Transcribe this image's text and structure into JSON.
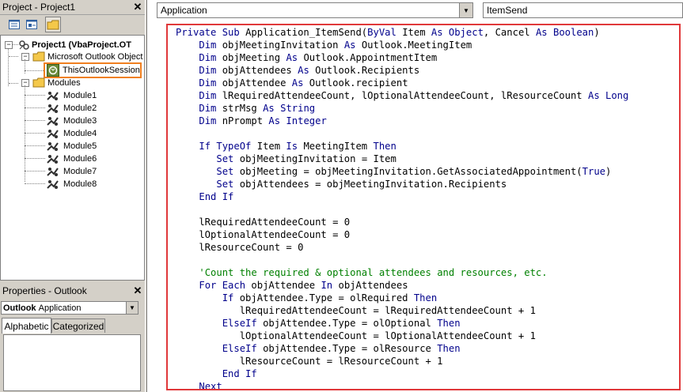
{
  "project_panel": {
    "title": "Project - Project1",
    "tree": {
      "root": "Project1 (VbaProject.OT",
      "folder_outlook": "Microsoft Outlook Object",
      "session": "ThisOutlookSession",
      "folder_modules": "Modules",
      "modules": [
        "Module1",
        "Module2",
        "Module3",
        "Module4",
        "Module5",
        "Module6",
        "Module7",
        "Module8"
      ]
    }
  },
  "properties_panel": {
    "title": "Properties - Outlook",
    "object_name": "Outlook",
    "object_type": "Application",
    "tabs": [
      "Alphabetic",
      "Categorized"
    ]
  },
  "editor": {
    "object_combo": "Application",
    "procedure_combo": "ItemSend",
    "code_lines": [
      [
        [
          "kw",
          "Private Sub "
        ],
        [
          "",
          "Application_ItemSend("
        ],
        [
          "kw",
          "ByVal "
        ],
        [
          "",
          "Item "
        ],
        [
          "kw",
          "As Object"
        ],
        [
          "",
          ", Cancel "
        ],
        [
          "kw",
          "As Boolean"
        ],
        [
          "",
          ")"
        ]
      ],
      [
        [
          "",
          "    "
        ],
        [
          "kw",
          "Dim "
        ],
        [
          "",
          "objMeetingInvitation "
        ],
        [
          "kw",
          "As "
        ],
        [
          "",
          "Outlook.MeetingItem"
        ]
      ],
      [
        [
          "",
          "    "
        ],
        [
          "kw",
          "Dim "
        ],
        [
          "",
          "objMeeting "
        ],
        [
          "kw",
          "As "
        ],
        [
          "",
          "Outlook.AppointmentItem"
        ]
      ],
      [
        [
          "",
          "    "
        ],
        [
          "kw",
          "Dim "
        ],
        [
          "",
          "objAttendees "
        ],
        [
          "kw",
          "As "
        ],
        [
          "",
          "Outlook.Recipients"
        ]
      ],
      [
        [
          "",
          "    "
        ],
        [
          "kw",
          "Dim "
        ],
        [
          "",
          "objAttendee "
        ],
        [
          "kw",
          "As "
        ],
        [
          "",
          "Outlook.recipient"
        ]
      ],
      [
        [
          "",
          "    "
        ],
        [
          "kw",
          "Dim "
        ],
        [
          "",
          "lRequiredAttendeeCount, lOptionalAttendeeCount, lResourceCount "
        ],
        [
          "kw",
          "As Long"
        ]
      ],
      [
        [
          "",
          "    "
        ],
        [
          "kw",
          "Dim "
        ],
        [
          "",
          "strMsg "
        ],
        [
          "kw",
          "As String"
        ]
      ],
      [
        [
          "",
          "    "
        ],
        [
          "kw",
          "Dim "
        ],
        [
          "",
          "nPrompt "
        ],
        [
          "kw",
          "As Integer"
        ]
      ],
      [
        [
          "",
          ""
        ]
      ],
      [
        [
          "",
          "    "
        ],
        [
          "kw",
          "If TypeOf "
        ],
        [
          "",
          "Item "
        ],
        [
          "kw",
          "Is "
        ],
        [
          "",
          "MeetingItem "
        ],
        [
          "kw",
          "Then"
        ]
      ],
      [
        [
          "",
          "       "
        ],
        [
          "kw",
          "Set "
        ],
        [
          "",
          "objMeetingInvitation = Item"
        ]
      ],
      [
        [
          "",
          "       "
        ],
        [
          "kw",
          "Set "
        ],
        [
          "",
          "objMeeting = objMeetingInvitation.GetAssociatedAppointment("
        ],
        [
          "kw",
          "True"
        ],
        [
          "",
          ")"
        ]
      ],
      [
        [
          "",
          "       "
        ],
        [
          "kw",
          "Set "
        ],
        [
          "",
          "objAttendees = objMeetingInvitation.Recipients"
        ]
      ],
      [
        [
          "",
          "    "
        ],
        [
          "kw",
          "End If"
        ]
      ],
      [
        [
          "",
          ""
        ]
      ],
      [
        [
          "",
          "    lRequiredAttendeeCount = 0"
        ]
      ],
      [
        [
          "",
          "    lOptionalAttendeeCount = 0"
        ]
      ],
      [
        [
          "",
          "    lResourceCount = 0"
        ]
      ],
      [
        [
          "",
          ""
        ]
      ],
      [
        [
          "",
          "    "
        ],
        [
          "cm",
          "'Count the required & optional attendees and resources, etc."
        ]
      ],
      [
        [
          "",
          "    "
        ],
        [
          "kw",
          "For Each "
        ],
        [
          "",
          "objAttendee "
        ],
        [
          "kw",
          "In "
        ],
        [
          "",
          "objAttendees"
        ]
      ],
      [
        [
          "",
          "        "
        ],
        [
          "kw",
          "If "
        ],
        [
          "",
          "objAttendee.Type = olRequired "
        ],
        [
          "kw",
          "Then"
        ]
      ],
      [
        [
          "",
          "           lRequiredAttendeeCount = lRequiredAttendeeCount + 1"
        ]
      ],
      [
        [
          "",
          "        "
        ],
        [
          "kw",
          "ElseIf "
        ],
        [
          "",
          "objAttendee.Type = olOptional "
        ],
        [
          "kw",
          "Then"
        ]
      ],
      [
        [
          "",
          "           lOptionalAttendeeCount = lOptionalAttendeeCount + 1"
        ]
      ],
      [
        [
          "",
          "        "
        ],
        [
          "kw",
          "ElseIf "
        ],
        [
          "",
          "objAttendee.Type = olResource "
        ],
        [
          "kw",
          "Then"
        ]
      ],
      [
        [
          "",
          "           lResourceCount = lResourceCount + 1"
        ]
      ],
      [
        [
          "",
          "        "
        ],
        [
          "kw",
          "End If"
        ]
      ],
      [
        [
          "",
          "    "
        ],
        [
          "kw",
          "Next"
        ]
      ]
    ]
  },
  "colors": {
    "keyword": "#00008b",
    "comment": "#008000",
    "highlight_box": "#e0383a",
    "session_box": "#f08020"
  }
}
